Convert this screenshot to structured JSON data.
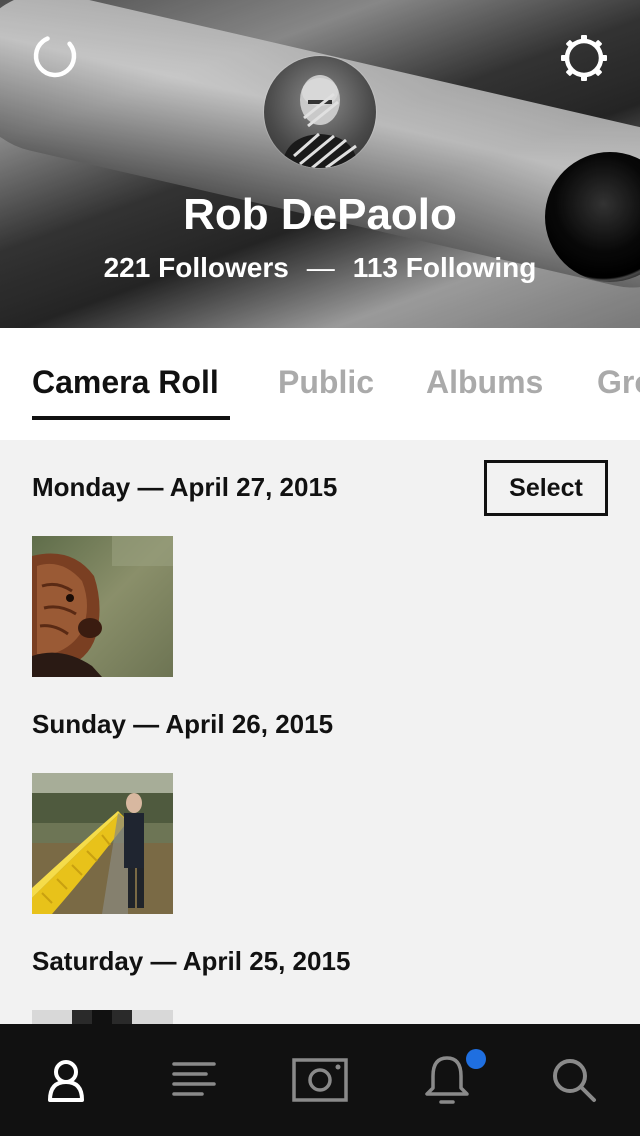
{
  "profile": {
    "name": "Rob DePaolo",
    "followers": "221 Followers",
    "separator": "—",
    "following": "113 Following"
  },
  "icons": {
    "refresh": "refresh-icon",
    "settings": "gear-icon"
  },
  "tabs": [
    {
      "label": "Camera Roll",
      "active": true
    },
    {
      "label": "Public",
      "active": false
    },
    {
      "label": "Albums",
      "active": false
    },
    {
      "label": "Groups",
      "active": false
    }
  ],
  "camera_roll": {
    "select_label": "Select",
    "days": [
      {
        "label": "Monday — April 27, 2015",
        "photo": "dog photo"
      },
      {
        "label": "Sunday — April 26, 2015",
        "photo": "boy leaning on fence photo"
      },
      {
        "label": "Saturday — April 25, 2015",
        "photo": "black and white photo"
      }
    ]
  },
  "bottom_nav": {
    "items": [
      "profile-icon",
      "feed-icon",
      "camera-icon",
      "notifications-icon",
      "search-icon"
    ],
    "active": "profile-icon",
    "notification_badge_color": "#1f6fe0"
  },
  "colors": {
    "accent": "#1f6fe0",
    "inactive_tab": "#aaaaaa",
    "text": "#111111",
    "content_bg": "#f2f2f2",
    "tabbar_bg": "#111111"
  }
}
